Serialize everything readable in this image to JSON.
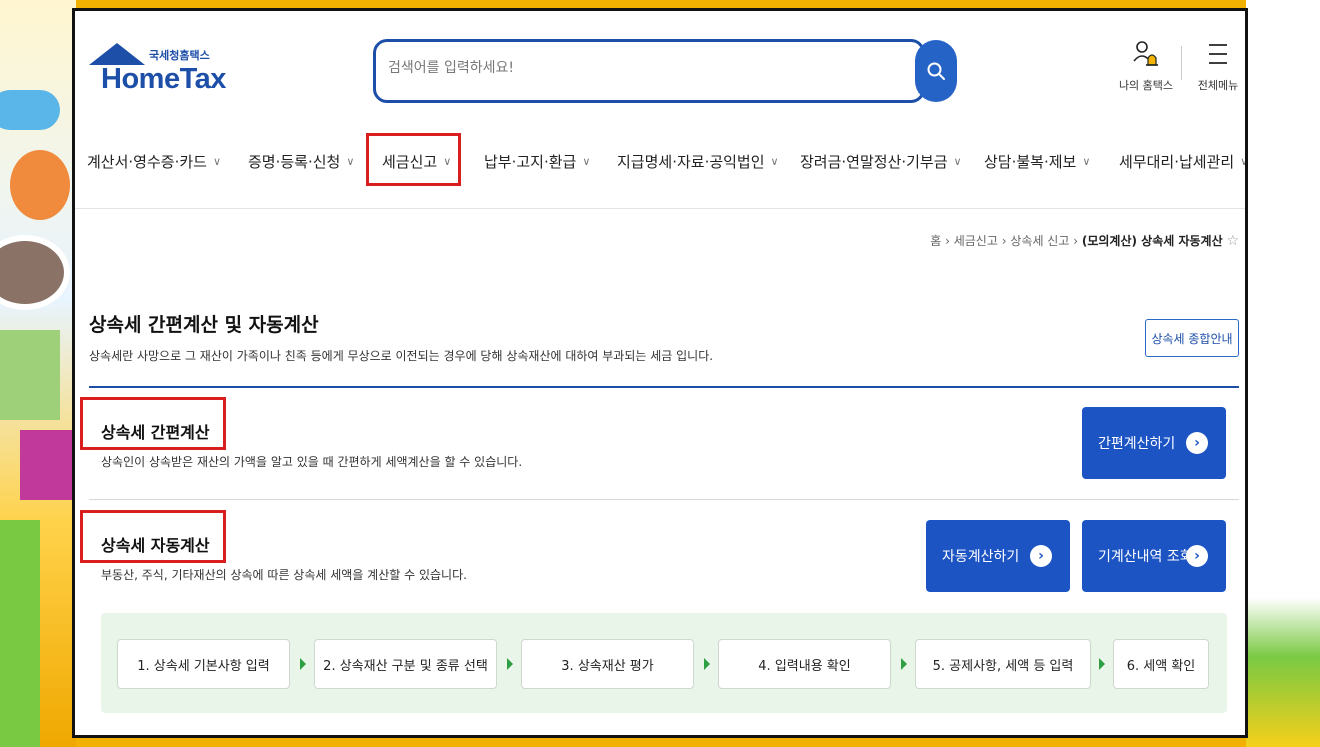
{
  "header": {
    "logo_sub": "국세청홈택스",
    "logo_main": "HomeTax",
    "search_placeholder": "검색어를 입력하세요!",
    "my_hometax": "나의 홈택스",
    "all_menu": "전체메뉴"
  },
  "nav": {
    "items": [
      {
        "label": "계산서·영수증·카드"
      },
      {
        "label": "증명·등록·신청"
      },
      {
        "label": "세금신고"
      },
      {
        "label": "납부·고지·환급"
      },
      {
        "label": "지급명세·자료·공익법인"
      },
      {
        "label": "장려금·연말정산·기부금"
      },
      {
        "label": "상담·불복·제보"
      },
      {
        "label": "세무대리·납세관리"
      }
    ],
    "chevron": "∨"
  },
  "breadcrumb": {
    "home": "홈",
    "level1": "세금신고",
    "level2": "상속세 신고",
    "current": "(모의계산) 상속세 자동계산",
    "sep": "›"
  },
  "page": {
    "title": "상속세 간편계산 및 자동계산",
    "description": "상속세란 사망으로 그 재산이 가족이나 친족 등에게 무상으로 이전되는 경우에 당해 상속재산에 대하여 부과되는 세금 입니다.",
    "guide_button": "상속세 종합안내"
  },
  "simple_calc": {
    "title": "상속세 간편계산",
    "description": "상속인이 상속받은 재산의 가액을 알고 있을 때 간편하게 세액계산을 할 수 있습니다.",
    "button": "간편계산하기"
  },
  "auto_calc": {
    "title": "상속세 자동계산",
    "description": "부동산, 주식, 기타재산의 상속에 따른 상속세 세액을 계산할 수 있습니다.",
    "button_auto": "자동계산하기",
    "button_history": "기계산내역 조회"
  },
  "steps": [
    "1. 상속세 기본사항 입력",
    "2. 상속재산 구분 및 종류 선택",
    "3. 상속재산 평가",
    "4. 입력내용 확인",
    "5. 공제사항, 세액 등 입력",
    "6. 세액 확인"
  ],
  "colors": {
    "brand": "#1d4fa8",
    "button": "#1d54c4",
    "highlight": "#d81e1e",
    "steps_bg": "#e9f5e9"
  }
}
